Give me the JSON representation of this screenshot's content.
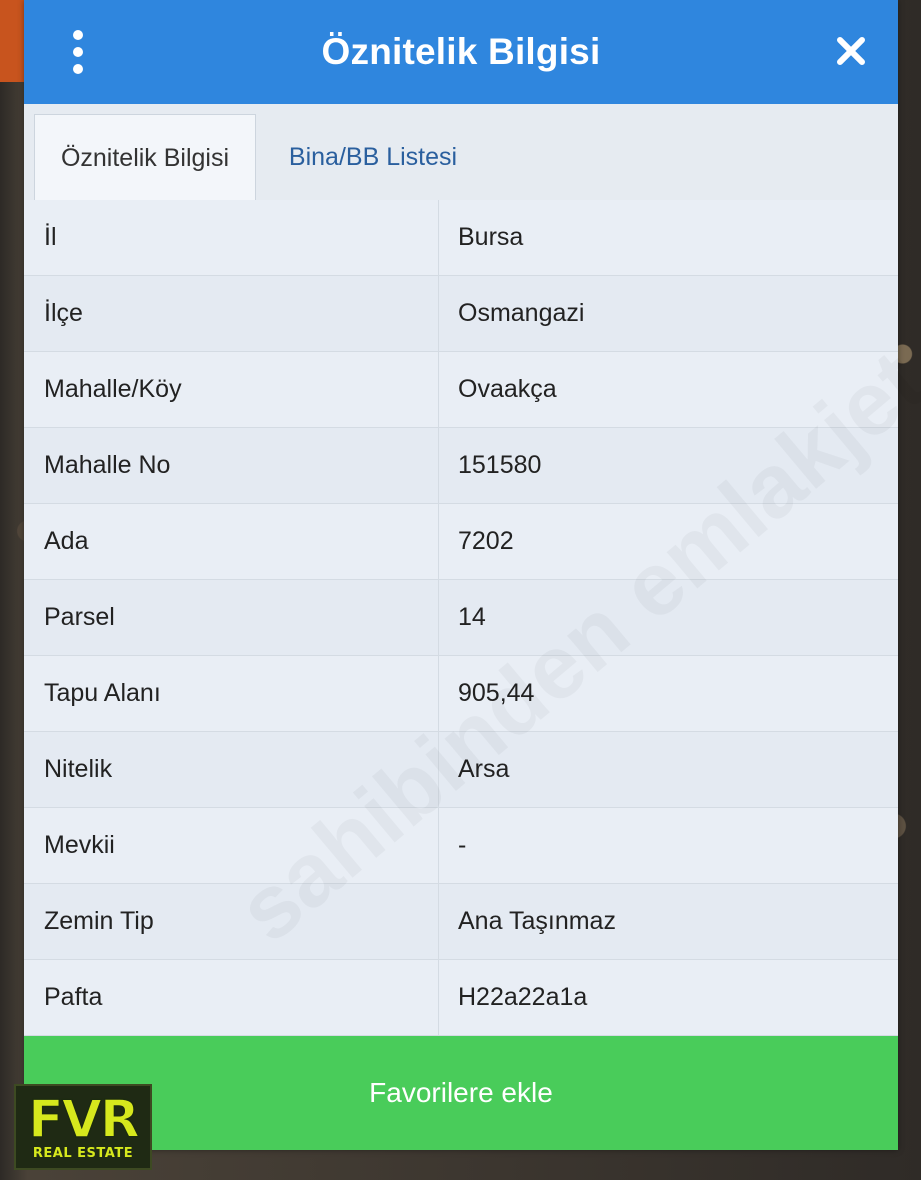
{
  "dialog": {
    "title": "Öznitelik Bilgisi",
    "menu_icon": "more-vertical-icon",
    "close_icon": "close-icon"
  },
  "tabs": [
    {
      "label": "Öznitelik Bilgisi",
      "active": true
    },
    {
      "label": "Bina/BB Listesi",
      "active": false
    }
  ],
  "rows": [
    {
      "label": "İl",
      "value": "Bursa"
    },
    {
      "label": "İlçe",
      "value": "Osmangazi"
    },
    {
      "label": "Mahalle/Köy",
      "value": "Ovaakça"
    },
    {
      "label": "Mahalle No",
      "value": "151580"
    },
    {
      "label": "Ada",
      "value": "7202"
    },
    {
      "label": "Parsel",
      "value": "14"
    },
    {
      "label": "Tapu Alanı",
      "value": "905,44"
    },
    {
      "label": "Nitelik",
      "value": "Arsa"
    },
    {
      "label": "Mevkii",
      "value": "-"
    },
    {
      "label": "Zemin Tip",
      "value": "Ana Taşınmaz"
    },
    {
      "label": "Pafta",
      "value": "H22a22a1a"
    }
  ],
  "footer": {
    "favorite_label": "Favorilere ekle"
  },
  "logo": {
    "main": "FVR",
    "sub": "REAL ESTATE"
  },
  "watermark": "sahibinden emlakjet .com",
  "colors": {
    "header": "#2f86de",
    "button": "#49cc5a",
    "tab_link": "#2a5f9e",
    "logo": "#d6e81d"
  }
}
